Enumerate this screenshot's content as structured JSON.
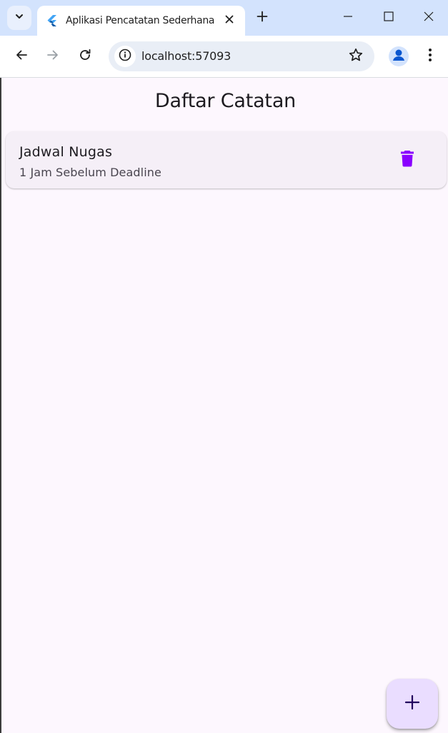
{
  "browser": {
    "tab": {
      "title": "Aplikasi Pencatatan Sederhana",
      "favicon": "flutter-logo-icon"
    },
    "address_bar": {
      "url": "localhost:57093"
    },
    "icons": {
      "tab_search": "chevron-down-icon",
      "close_tab": "close-icon",
      "new_tab": "plus-icon",
      "minimize": "minimize-icon",
      "maximize": "maximize-icon",
      "close_window": "close-icon",
      "back": "arrow-left-icon",
      "forward": "arrow-right-icon",
      "reload": "reload-icon",
      "site_info": "info-icon",
      "bookmark": "star-icon",
      "profile": "person-icon",
      "menu": "more-vertical-icon"
    },
    "colors": {
      "tabstrip": "#d3e3fd",
      "toolbar": "#ffffff",
      "omnibox": "#e9eef6"
    }
  },
  "app": {
    "title": "Daftar Catatan",
    "notes": [
      {
        "title": "Jadwal Nugas",
        "subtitle": "1 Jam Sebelum Deadline",
        "action_icon": "delete-icon"
      }
    ],
    "fab_icon": "plus-icon",
    "colors": {
      "background": "#fdf7fe",
      "card": "#f5eff7",
      "delete_icon": "#8a00ff",
      "fab": "#eaddff",
      "fab_icon": "#21005d"
    }
  }
}
